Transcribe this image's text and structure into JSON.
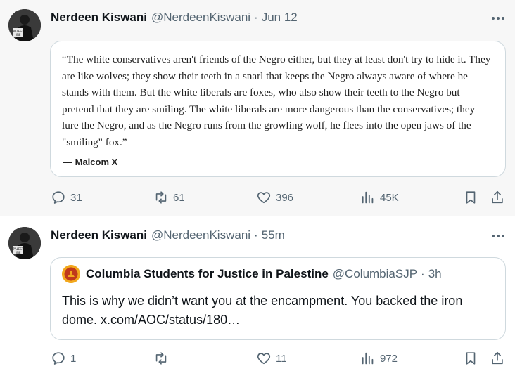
{
  "posts": [
    {
      "author_name": "Nerdeen Kiswani",
      "author_handle": "@NerdeenKiswani",
      "separator": "·",
      "time": "Jun 12",
      "quote": {
        "text": "“The white conservatives aren't friends of the Negro either, but they at least don't try to hide it. They are like wolves; they show their teeth in a snarl that keeps the Negro always aware of where he stands with them. But the white liberals are foxes, who also show their teeth to the Negro but pretend that they are smiling. The white liberals are more dangerous than the conservatives; they lure the Negro, and as the Negro runs from the growling wolf, he flees into the open jaws of the \"smiling\" fox.”",
        "attribution": "— Malcom X"
      },
      "actions": {
        "replies": "31",
        "reposts": "61",
        "likes": "396",
        "views": "45K"
      }
    },
    {
      "author_name": "Nerdeen Kiswani",
      "author_handle": "@NerdeenKiswani",
      "separator": "·",
      "time": "55m",
      "quoted_post": {
        "author_name": "Columbia Students for Justice in Palestine",
        "author_handle": "@ColumbiaSJP",
        "separator": "·",
        "time": "3h",
        "text": "This is why we didn’t want you at the encampment. You backed the iron dome. x.com/AOC/status/180…"
      },
      "actions": {
        "replies": "1",
        "reposts": "",
        "likes": "11",
        "views": "972"
      }
    }
  ],
  "icons": {
    "reply": "reply-icon",
    "repost": "repost-icon",
    "like": "heart-icon",
    "views": "views-icon",
    "bookmark": "bookmark-icon",
    "share": "share-icon",
    "more": "more-icon"
  },
  "colors": {
    "text_primary": "#0f1419",
    "text_secondary": "#536471",
    "border": "#cfd9de",
    "thread_background": "#f7f7f7",
    "csjp_avatar": "#f2a81d"
  }
}
